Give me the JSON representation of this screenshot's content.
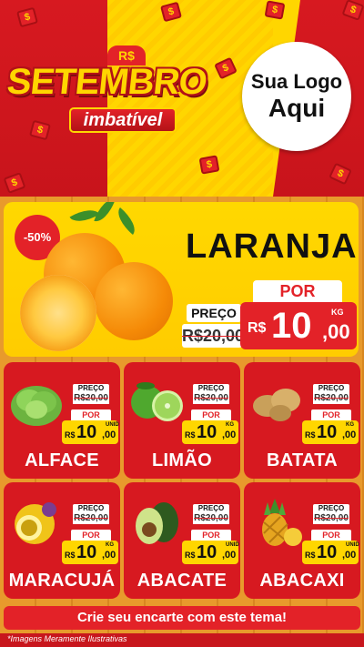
{
  "colors": {
    "brand_red": "#e32228",
    "brand_yellow": "#ffd600",
    "wood": "#e89a2c"
  },
  "header": {
    "currency_badge": "R$",
    "title": "SETEMBRO",
    "subtitle": "imbatível",
    "logo_placeholder": {
      "line1": "Sua Logo",
      "line2": "Aqui"
    }
  },
  "hero": {
    "discount": "-50%",
    "product": "LARANJA",
    "old_label": "PREÇO",
    "old_price": "R$20,00",
    "new_label": "POR",
    "currency": "R$",
    "price_int": "10",
    "price_dec": ",00",
    "unit": "KG",
    "image_icon": "orange-icon"
  },
  "products": [
    {
      "name": "ALFACE",
      "old_label": "PREÇO",
      "old_price": "R$20,00",
      "new_label": "POR",
      "currency": "R$",
      "price_int": "10",
      "price_dec": ",00",
      "unit": "UNID",
      "icon": "lettuce-icon"
    },
    {
      "name": "LIMÃO",
      "old_label": "PREÇO",
      "old_price": "R$20,00",
      "new_label": "POR",
      "currency": "R$",
      "price_int": "10",
      "price_dec": ",00",
      "unit": "KG",
      "icon": "lime-icon"
    },
    {
      "name": "BATATA",
      "old_label": "PREÇO",
      "old_price": "R$20,00",
      "new_label": "POR",
      "currency": "R$",
      "price_int": "10",
      "price_dec": ",00",
      "unit": "KG",
      "icon": "potato-icon"
    },
    {
      "name": "MARACUJÁ",
      "old_label": "PREÇO",
      "old_price": "R$20,00",
      "new_label": "POR",
      "currency": "R$",
      "price_int": "10",
      "price_dec": ",00",
      "unit": "KG",
      "icon": "passion-fruit-icon"
    },
    {
      "name": "ABACATE",
      "old_label": "PREÇO",
      "old_price": "R$20,00",
      "new_label": "POR",
      "currency": "R$",
      "price_int": "10",
      "price_dec": ",00",
      "unit": "UNID",
      "icon": "avocado-icon"
    },
    {
      "name": "ABACAXI",
      "old_label": "PREÇO",
      "old_price": "R$20,00",
      "new_label": "POR",
      "currency": "R$",
      "price_int": "10",
      "price_dec": ",00",
      "unit": "UNID",
      "icon": "pineapple-icon"
    }
  ],
  "cta": "Crie seu encarte com este tema!",
  "footnote": "*Imagens Meramente Ilustrativas"
}
